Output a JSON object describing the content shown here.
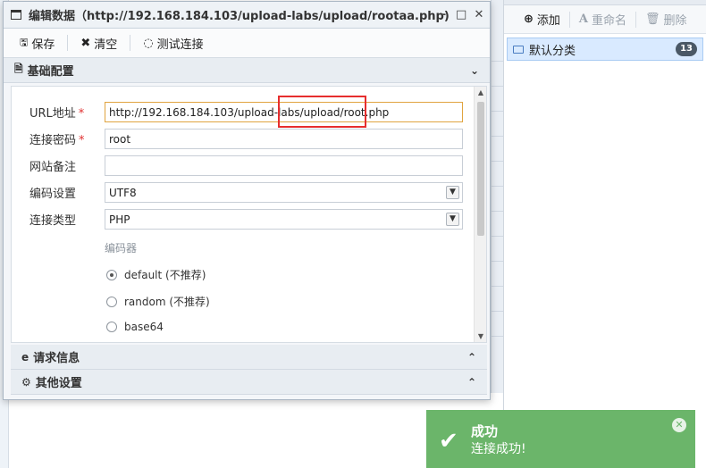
{
  "dialog": {
    "title": "编辑数据（http://192.168.184.103/upload-labs/upload/rootaa.php)",
    "controls": {
      "minimize": "–",
      "maximize": "□",
      "close": "✕"
    }
  },
  "toolbar": {
    "save_label": "保存",
    "clear_label": "清空",
    "test_label": "测试连接"
  },
  "sections": {
    "basic": "基础配置",
    "request": "请求信息",
    "other": "其他设置"
  },
  "form": {
    "url_label": "URL地址",
    "url_value": "http://192.168.184.103/upload-labs/upload/root.php",
    "password_label": "连接密码",
    "password_value": "root",
    "note_label": "网站备注",
    "note_value": "",
    "encoding_label": "编码设置",
    "encoding_value": "UTF8",
    "type_label": "连接类型",
    "type_value": "PHP",
    "encoder_title": "编码器",
    "encoders": [
      "default (不推荐)",
      "random (不推荐)",
      "base64"
    ],
    "required_mark": "*"
  },
  "right_panel": {
    "add_label": "添加",
    "rename_label": "重命名",
    "delete_label": "删除",
    "category_label": "默认分类",
    "category_count": "13"
  },
  "toast": {
    "title": "成功",
    "message": "连接成功!"
  },
  "colors": {
    "toast_bg": "#6bb56a",
    "highlight_box": "#e62e2e",
    "selected_item": "#d9eaff"
  }
}
